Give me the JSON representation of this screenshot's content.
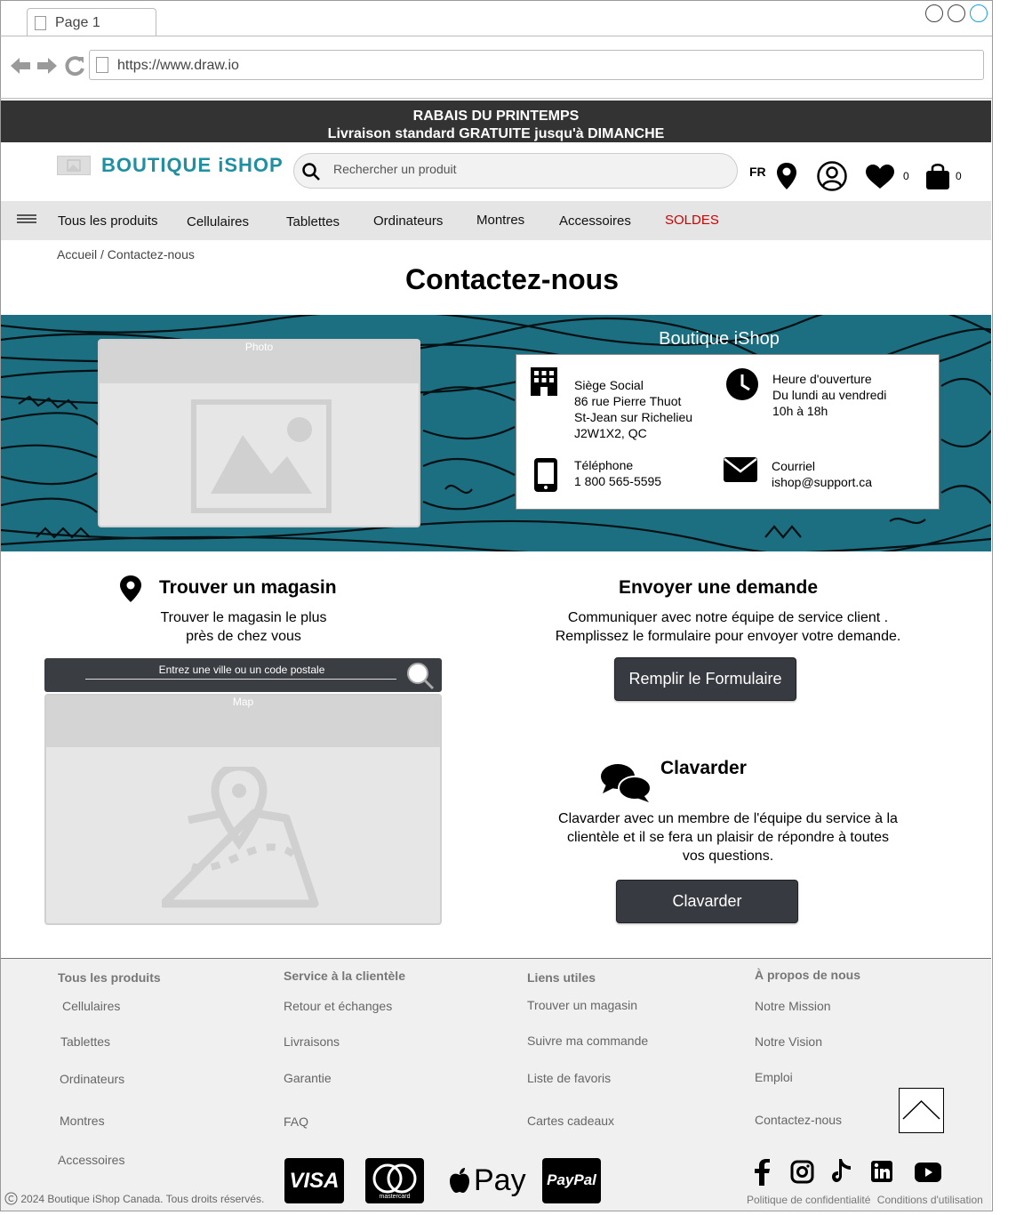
{
  "browser": {
    "tab_title": "Page 1",
    "url": "https://www.draw.io"
  },
  "promo": {
    "line1": "RABAIS DU PRINTEMPS",
    "line2": "Livraison standard GRATUITE jusqu'à DIMANCHE"
  },
  "header": {
    "logo_text": "BOUTIQUE iSHOP",
    "search_placeholder": "Rechercher un produit",
    "language": "FR",
    "wishlist_count": "0",
    "cart_count": "0",
    "icons": [
      "location-icon",
      "account-icon",
      "heart-icon",
      "shopping-bag-icon"
    ]
  },
  "nav": {
    "items": [
      "Tous les produits",
      "Cellulaires",
      "Tablettes",
      "Ordinateurs",
      "Montres",
      "Accessoires",
      "SOLDES"
    ],
    "sale_color": "#cc0000"
  },
  "breadcrumb": "Accueil / Contactez-nous",
  "page_title": "Contactez-nous",
  "banner": {
    "photo_label": "Photo",
    "store_title": "Boutique iShop",
    "hq": {
      "label": "Siège Social",
      "line1": "86 rue Pierre Thuot",
      "line2": "St-Jean sur Richelieu",
      "line3": "J2W1X2, QC"
    },
    "hours": {
      "label": "Heure d'ouverture",
      "line1": "Du lundi au vendredi",
      "line2": "10h à 18h"
    },
    "phone": {
      "label": "Téléphone",
      "value": "1 800 565-5595"
    },
    "email": {
      "label": "Courriel",
      "value": "ishop@support.ca"
    },
    "accent_color": "#1c6f80"
  },
  "find_store": {
    "title": "Trouver un magasin",
    "text1": "Trouver le magasin le plus",
    "text2": "près de chez vous",
    "search_placeholder": "Entrez une ville ou un code postale",
    "map_label": "Map"
  },
  "request": {
    "title": "Envoyer une demande",
    "text1": "Communiquer avec notre équipe de service client .",
    "text2": "Remplissez le formulaire pour envoyer votre demande.",
    "button": "Remplir le Formulaire"
  },
  "chat": {
    "title": "Clavarder",
    "text1": "Clavarder avec un membre de l'équipe du service à la",
    "text2": "clientèle et il se fera un plaisir de répondre à toutes",
    "text3": "vos questions.",
    "button": "Clavarder"
  },
  "footer": {
    "columns": [
      {
        "heading": "Tous les produits",
        "links": [
          "Cellulaires",
          "Tablettes",
          "Ordinateurs",
          "Montres",
          "Accessoires"
        ]
      },
      {
        "heading": "Service à la clientèle",
        "links": [
          "Retour et échanges",
          "Livraisons",
          "Garantie",
          "FAQ"
        ]
      },
      {
        "heading": "Liens utiles",
        "links": [
          "Trouver un magasin",
          "Suivre ma commande",
          "Liste de favoris",
          "Cartes cadeaux"
        ]
      },
      {
        "heading": "À propos de nous",
        "links": [
          "Notre Mission",
          "Notre Vision",
          "Emploi",
          "Contactez-nous"
        ]
      }
    ],
    "payments": [
      "VISA",
      "mastercard",
      "Pay",
      "PayPal"
    ],
    "social_icons": [
      "facebook-icon",
      "instagram-icon",
      "tiktok-icon",
      "linkedin-icon",
      "youtube-icon"
    ],
    "copyright": "2024 Boutique iShop Canada. Tous droits réservés.",
    "privacy": "Politique de confidentialité",
    "terms": "Conditions d'utilisation"
  }
}
